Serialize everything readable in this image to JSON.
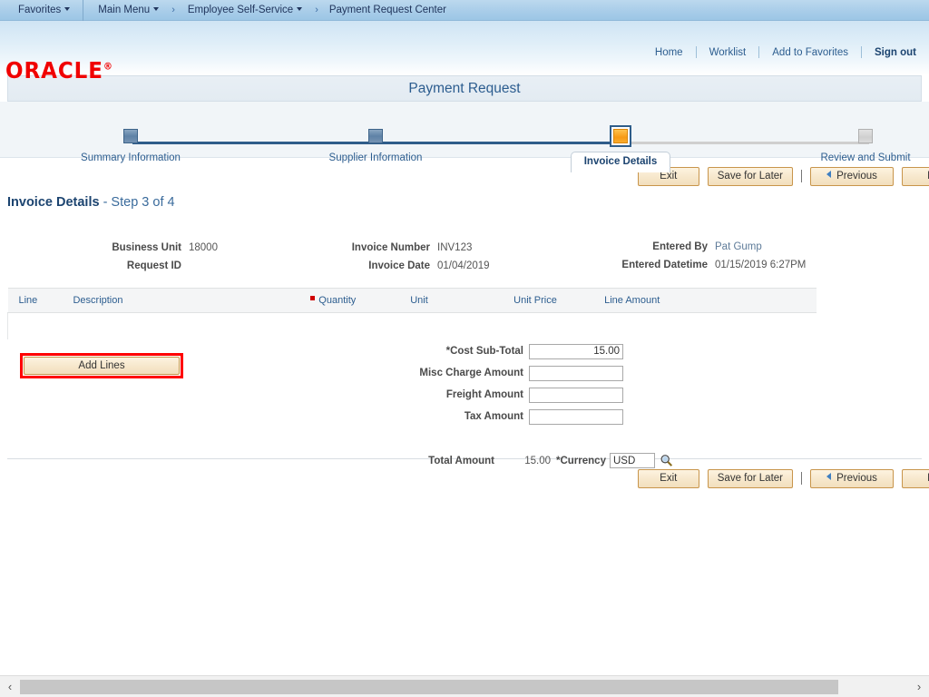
{
  "nav": {
    "favorites": "Favorites",
    "main_menu": "Main Menu",
    "breadcrumb_1": "Employee Self-Service",
    "breadcrumb_2": "Payment Request Center",
    "separator": "›"
  },
  "brand": {
    "logo_text": "ORACLE",
    "registered_mark": "®"
  },
  "utility_links": {
    "home": "Home",
    "worklist": "Worklist",
    "add_to_favorites": "Add to Favorites",
    "sign_out": "Sign out"
  },
  "page": {
    "title": "Payment Request",
    "section_heading_bold": "Invoice Details",
    "section_heading_rest": " - Step 3 of 4"
  },
  "train": {
    "steps": [
      {
        "label": "Summary Information",
        "state": "done"
      },
      {
        "label": "Supplier Information",
        "state": "done"
      },
      {
        "label": "Invoice Details",
        "state": "current"
      },
      {
        "label": "Review and Submit",
        "state": "future"
      }
    ]
  },
  "toolbar": {
    "exit": "Exit",
    "save_for_later": "Save for Later",
    "previous": "Previous",
    "next": "Next",
    "divider": "|"
  },
  "invoice_info": {
    "business_unit_label": "Business Unit",
    "business_unit_value": "18000",
    "request_id_label": "Request ID",
    "request_id_value": "",
    "invoice_number_label": "Invoice Number",
    "invoice_number_value": "INV123",
    "invoice_date_label": "Invoice Date",
    "invoice_date_value": "01/04/2019",
    "entered_by_label": "Entered By",
    "entered_by_value": "Pat Gump",
    "entered_datetime_label": "Entered Datetime",
    "entered_datetime_value": "01/15/2019  6:27PM"
  },
  "lines_table": {
    "columns": [
      {
        "label": "Line",
        "required": false
      },
      {
        "label": "Description",
        "required": false
      },
      {
        "label": "Quantity",
        "required": true
      },
      {
        "label": "Unit",
        "required": false
      },
      {
        "label": "Unit Price",
        "required": false
      },
      {
        "label": "Line Amount",
        "required": false
      }
    ],
    "rows": []
  },
  "actions": {
    "add_lines": "Add Lines"
  },
  "amounts": {
    "cost_sub_total_label": "*Cost Sub-Total",
    "cost_sub_total_value": "15.00",
    "misc_charge_label": "Misc Charge Amount",
    "misc_charge_value": "",
    "freight_label": "Freight Amount",
    "freight_value": "",
    "tax_label": "Tax Amount",
    "tax_value": "",
    "total_amount_label": "Total Amount",
    "total_amount_value": "15.00",
    "currency_label": "*Currency",
    "currency_value": "USD"
  },
  "scrollbar": {
    "left_arrow": "‹",
    "right_arrow": "›"
  },
  "colors": {
    "accent_blue": "#2c5d8f",
    "oracle_red": "#f00000",
    "highlight_red": "#ff0000",
    "step_active_orange": "#f79a14",
    "button_tan": "#f7e8cd"
  }
}
